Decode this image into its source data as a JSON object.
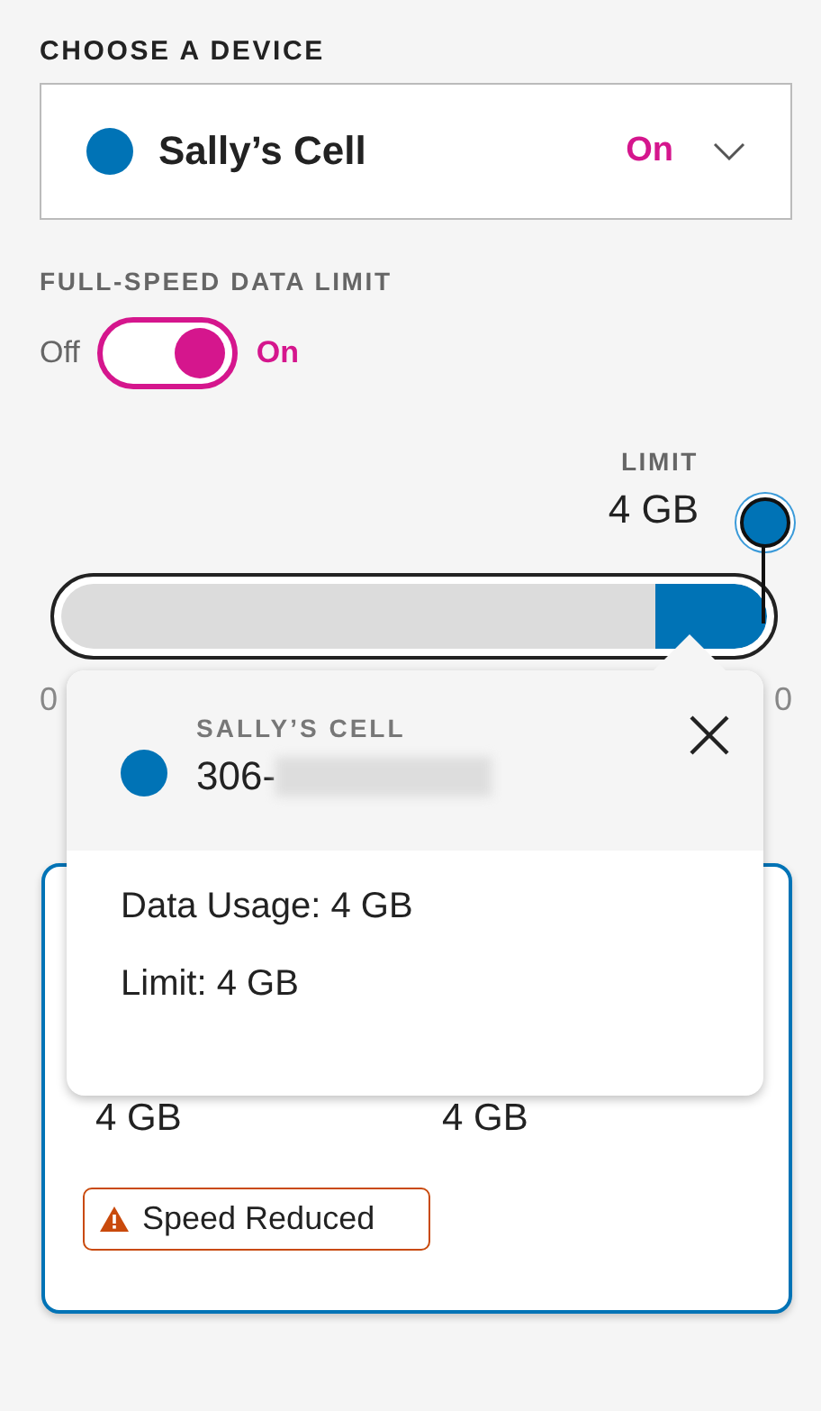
{
  "device_picker": {
    "heading": "CHOOSE A DEVICE",
    "device_name": "Sally’s Cell",
    "status": "On"
  },
  "data_limit": {
    "heading": "FULL-SPEED DATA LIMIT",
    "off_label": "Off",
    "on_label": "On",
    "on": true
  },
  "limit_slider": {
    "label": "LIMIT",
    "value": "4 GB",
    "min_label": "0",
    "max_label": "0"
  },
  "popover": {
    "device_name": "SALLY’S CELL",
    "number_visible": "306-",
    "lines": [
      "Data Usage: 4 GB",
      "Limit: 4 GB"
    ]
  },
  "usage_card": {
    "values": [
      "4 GB",
      "4 GB"
    ],
    "badge": "Speed Reduced"
  }
}
